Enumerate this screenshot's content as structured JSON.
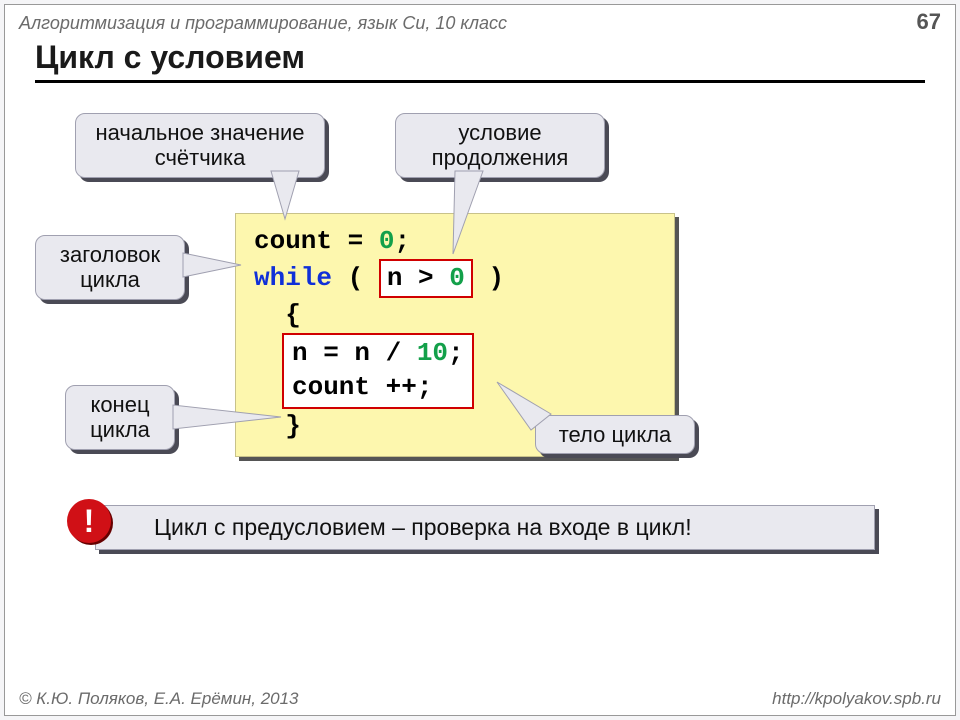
{
  "header": {
    "course": "Алгоритмизация и программирование, язык Си, 10 класс",
    "page": "67"
  },
  "title": "Цикл с условием",
  "callouts": {
    "initial": "начальное значение\nсчётчика",
    "condition": "условие\nпродолжения",
    "header_label": "заголовок\nцикла",
    "end_label": "конец\nцикла",
    "body_label": "тело цикла"
  },
  "code": {
    "l1_a": "count",
    "l1_b": " = ",
    "l1_c": "0",
    "l1_d": ";",
    "l2_a": "while",
    "l2_b": " ( ",
    "l2_c": "n > ",
    "l2_d": "0",
    "l2_e": " )",
    "l3": "  {",
    "l4_a": "n = n / ",
    "l4_b": "10",
    "l4_c": ";",
    "l5": "count ++;",
    "l6": "  }"
  },
  "note": {
    "mark": "!",
    "text": "Цикл с предусловием – проверка на входе в цикл!"
  },
  "footer": {
    "left": "© К.Ю. Поляков, Е.А. Ерёмин, 2013",
    "right": "http://kpolyakov.spb.ru"
  }
}
